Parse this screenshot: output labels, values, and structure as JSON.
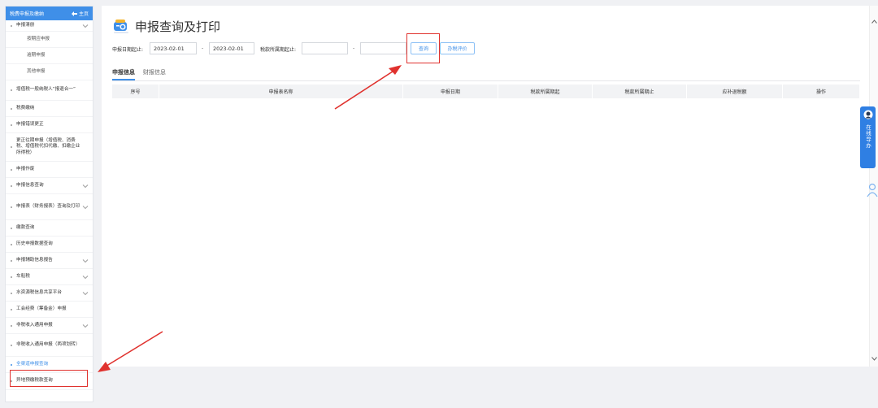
{
  "sidebar": {
    "header_title": "税费申报及缴纳",
    "home_label": "主页",
    "items": [
      {
        "label": "申报清册",
        "level": 0,
        "chevron": true
      },
      {
        "label": "按期应申报",
        "level": 1
      },
      {
        "label": "逾期申报",
        "level": 1
      },
      {
        "label": "其他申报",
        "level": 1
      },
      {
        "label": "增值税一般纳税人“报退合一”",
        "level": 0
      },
      {
        "label": "税费缴纳",
        "level": 0
      },
      {
        "label": "申报错误更正",
        "level": 0
      },
      {
        "label": "更正往期申报（增值税、消费税、增值税代扣代缴、扣缴企业所得税）",
        "level": 0
      },
      {
        "label": "申报作废",
        "level": 0
      },
      {
        "label": "申报信息查询",
        "level": 0,
        "chevron": true
      },
      {
        "label": "申报表（财务报表）查询及打印",
        "level": 0,
        "chevron": true
      },
      {
        "label": "缴款查询",
        "level": 0
      },
      {
        "label": "历史申报数据查询",
        "level": 0
      },
      {
        "label": "申报辅助信息报告",
        "level": 0,
        "chevron": true
      },
      {
        "label": "车船税",
        "level": 0,
        "chevron": true
      },
      {
        "label": "水资源税信息共享平台",
        "level": 0,
        "chevron": true
      },
      {
        "label": "工会经费（筹备金）申报",
        "level": 0
      },
      {
        "label": "非税收入通用申报",
        "level": 0,
        "chevron": true
      },
      {
        "label": "非税收入通用申报（两项划转）",
        "level": 0
      },
      {
        "label": "全渠道申报查询",
        "level": 0,
        "active": true
      },
      {
        "label": "异地预缴税款查询",
        "level": 0
      }
    ]
  },
  "main": {
    "title": "申报查询及打印",
    "filters": {
      "declare_date_label": "申报日期起止:",
      "date_start": "2023-02-01",
      "date_end": "2023-02-01",
      "separator": "-",
      "tax_period_label": "税款所属期起止:",
      "period_start": "",
      "period_end": ""
    },
    "buttons": {
      "query": "查询",
      "evaluate": "办税评价"
    },
    "tabs": [
      {
        "label": "申报信息",
        "active": true
      },
      {
        "label": "财报信息",
        "active": false
      }
    ],
    "table_headers": [
      "序号",
      "申报表名称",
      "申报日期",
      "税款所属期起",
      "税款所属期止",
      "应补退税额",
      "操作"
    ]
  },
  "widgets": {
    "online_help_label": "在线导办"
  },
  "colors": {
    "accent": "#3f8fe8",
    "annotation": "#e0322e"
  }
}
